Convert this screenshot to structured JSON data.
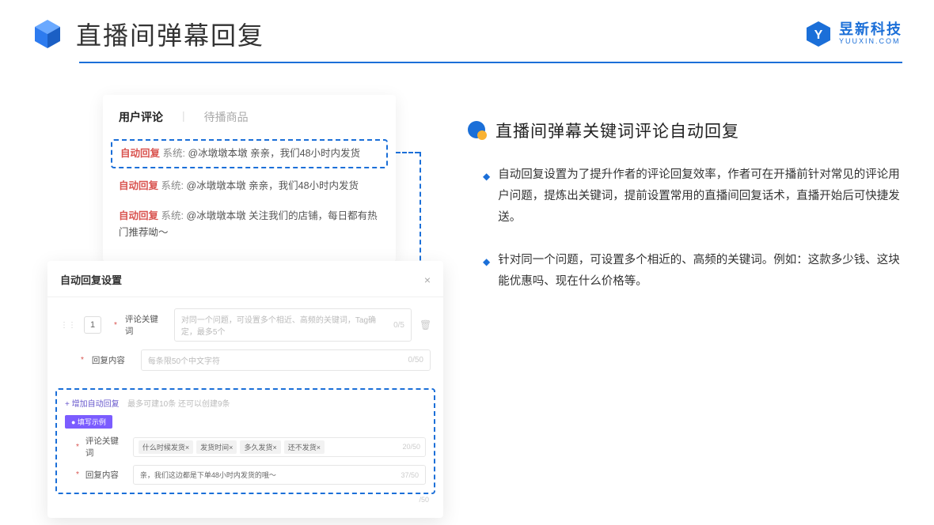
{
  "header": {
    "title": "直播间弹幕回复",
    "brand_name": "昱新科技",
    "brand_url": "YUUXIN.COM"
  },
  "comments": {
    "tab_active": "用户评论",
    "tab_inactive": "待播商品",
    "rows": [
      {
        "auto": "自动回复",
        "sys": "系统:",
        "text": "@冰墩墩本墩 亲亲，我们48小时内发货"
      },
      {
        "auto": "自动回复",
        "sys": "系统:",
        "text": "@冰墩墩本墩 亲亲，我们48小时内发货"
      },
      {
        "auto": "自动回复",
        "sys": "系统:",
        "text": "@冰墩墩本墩 关注我们的店铺，每日都有热门推荐呦～"
      }
    ]
  },
  "settings": {
    "title": "自动回复设置",
    "index": "1",
    "field1_label": "评论关键词",
    "field1_placeholder": "对同一个问题，可设置多个相近、高频的关键词，Tag确定，最多5个",
    "field1_count": "0/5",
    "field2_label": "回复内容",
    "field2_placeholder": "每条限50个中文字符",
    "field2_count": "0/50",
    "add_link": "+ 增加自动回复",
    "add_hint": "最多可建10条 还可以创建9条",
    "example_tag": "● 填写示例",
    "ex_field1_label": "评论关键词",
    "ex_chips": [
      "什么时候发货×",
      "发货时间×",
      "多久发货×",
      "还不发货×"
    ],
    "ex_field1_count": "20/50",
    "ex_field2_label": "回复内容",
    "ex_field2_value": "亲，我们这边都是下单48小时内发货的哦～",
    "ex_field2_count": "37/50",
    "outer_count": "/50"
  },
  "right": {
    "section_title": "直播间弹幕关键词评论自动回复",
    "bullet1": "自动回复设置为了提升作者的评论回复效率，作者可在开播前针对常见的评论用户问题，提炼出关键词，提前设置常用的直播间回复话术，直播开始后可快捷发送。",
    "bullet2": "针对同一个问题，可设置多个相近的、高频的关键词。例如：这款多少钱、这块能优惠吗、现在什么价格等。"
  }
}
